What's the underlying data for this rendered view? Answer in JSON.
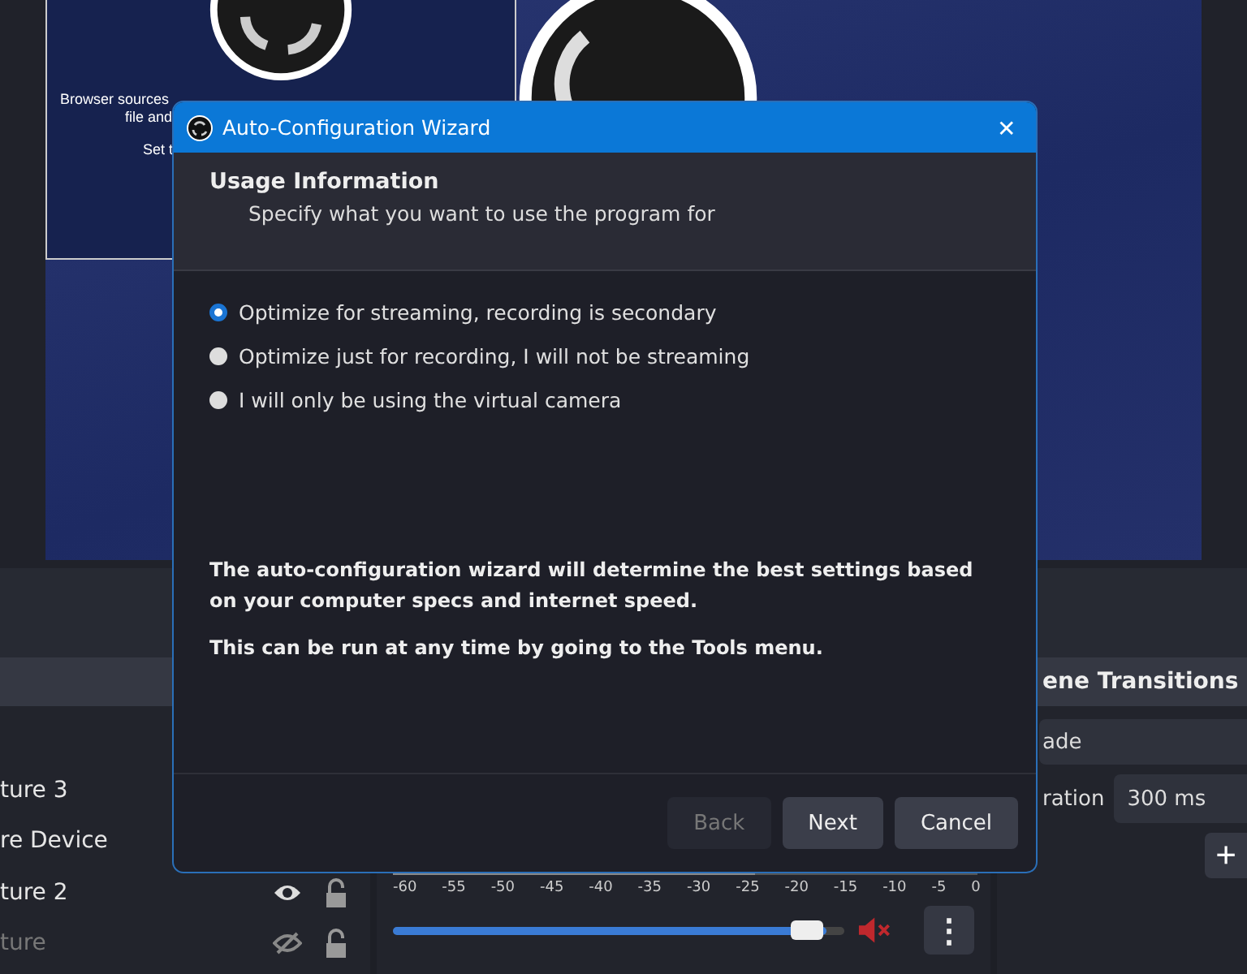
{
  "preview": {
    "scene_text": [
      "Browser sources",
      "file and",
      "Set t"
    ]
  },
  "sources": [
    {
      "name": "ture 3"
    },
    {
      "name": "re Device"
    },
    {
      "name": "ture 2",
      "visible": true,
      "locked": false
    },
    {
      "name": "ture",
      "visible": false,
      "locked": false
    }
  ],
  "mixer": {
    "ticks": [
      "-60",
      "-55",
      "-50",
      "-45",
      "-40",
      "-35",
      "-30",
      "-25",
      "-20",
      "-15",
      "-10",
      "-5",
      "0"
    ],
    "level": 0.96,
    "muted": true,
    "menu": "⋮"
  },
  "transitions": {
    "title": "ene Transitions",
    "transition": "ade",
    "duration_label": "ration",
    "duration": "300 ms",
    "add": "+"
  },
  "dialog": {
    "title": "Auto-Configuration Wizard",
    "close": "✕",
    "heading": "Usage Information",
    "subheading": "Specify what you want to use the program for",
    "options": [
      {
        "label": "Optimize for streaming, recording is secondary",
        "selected": true
      },
      {
        "label": "Optimize just for recording, I will not be streaming",
        "selected": false
      },
      {
        "label": "I will only be using the virtual camera",
        "selected": false
      }
    ],
    "notes": [
      "The auto-configuration wizard will determine the best settings based on your computer specs and internet speed.",
      "This can be run at any time by going to the Tools menu."
    ],
    "buttons": [
      {
        "label": "Back",
        "disabled": true
      },
      {
        "label": "Next",
        "disabled": false
      },
      {
        "label": "Cancel",
        "disabled": false
      }
    ]
  }
}
